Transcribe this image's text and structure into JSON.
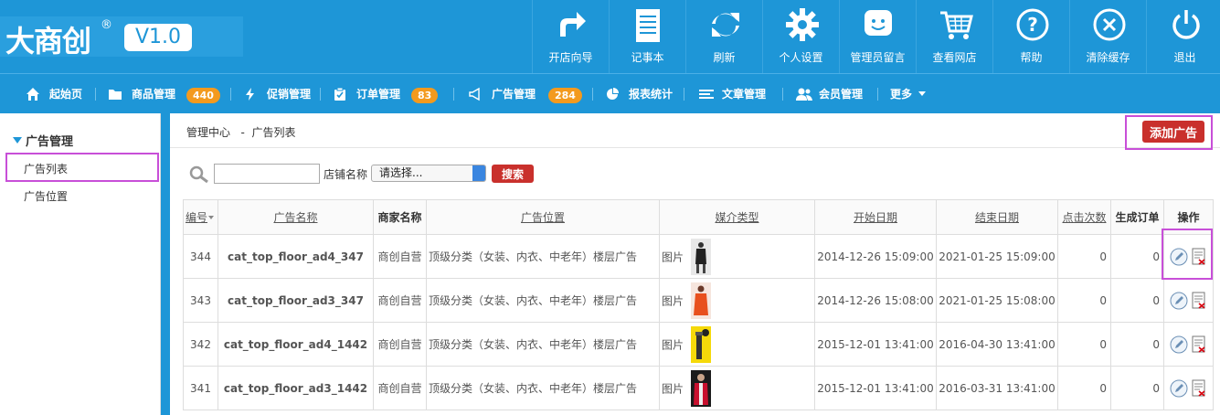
{
  "brand": {
    "logo": "大商创",
    "reg": "®",
    "version": "V1.0"
  },
  "toolbar": [
    {
      "label": "开店向导",
      "icon": "share-arrow-icon"
    },
    {
      "label": "记事本",
      "icon": "notepad-icon"
    },
    {
      "label": "刷新",
      "icon": "refresh-icon"
    },
    {
      "label": "个人设置",
      "icon": "gear-icon"
    },
    {
      "label": "管理员留言",
      "icon": "chat-smile-icon"
    },
    {
      "label": "查看网店",
      "icon": "cart-icon"
    },
    {
      "label": "帮助",
      "icon": "help-icon"
    },
    {
      "label": "清除缓存",
      "icon": "close-circle-icon"
    },
    {
      "label": "退出",
      "icon": "power-icon"
    }
  ],
  "nav": {
    "home": "起始页",
    "goods": "商品管理",
    "goods_badge": "440",
    "promo": "促销管理",
    "orders": "订单管理",
    "orders_badge": "83",
    "ads": "广告管理",
    "ads_badge": "284",
    "reports": "报表统计",
    "articles": "文章管理",
    "members": "会员管理",
    "more": "更多"
  },
  "sidebar": {
    "title": "广告管理",
    "items": [
      {
        "label": "广告列表"
      },
      {
        "label": "广告位置"
      }
    ]
  },
  "breadcrumb": {
    "root": "管理中心",
    "sep": "-",
    "current": "广告列表"
  },
  "actions": {
    "add_label": "添加广告"
  },
  "search": {
    "shop_label": "店铺名称",
    "select_value": "请选择...",
    "button": "搜索"
  },
  "table": {
    "headers": [
      "编号",
      "广告名称",
      "商家名称",
      "广告位置",
      "媒介类型",
      "开始日期",
      "结束日期",
      "点击次数",
      "生成订单",
      "操作"
    ],
    "rows": [
      {
        "id": "344",
        "name": "cat_top_floor_ad4_347",
        "shop": "商创自营",
        "position": "顶级分类（女装、内衣、中老年）楼层广告",
        "media": "图片",
        "start": "2014-12-26 15:09:00",
        "end": "2021-01-25 15:09:00",
        "clicks": "0",
        "orders": "0"
      },
      {
        "id": "343",
        "name": "cat_top_floor_ad3_347",
        "shop": "商创自营",
        "position": "顶级分类（女装、内衣、中老年）楼层广告",
        "media": "图片",
        "start": "2014-12-26 15:08:00",
        "end": "2021-01-25 15:08:00",
        "clicks": "0",
        "orders": "0"
      },
      {
        "id": "342",
        "name": "cat_top_floor_ad4_1442",
        "shop": "商创自营",
        "position": "顶级分类（女装、内衣、中老年）楼层广告",
        "media": "图片",
        "start": "2015-12-01 13:41:00",
        "end": "2016-04-30 13:41:00",
        "clicks": "0",
        "orders": "0"
      },
      {
        "id": "341",
        "name": "cat_top_floor_ad3_1442",
        "shop": "商创自营",
        "position": "顶级分类（女装、内衣、中老年）楼层广告",
        "media": "图片",
        "start": "2015-12-01 13:41:00",
        "end": "2016-03-31 13:41:00",
        "clicks": "0",
        "orders": "0"
      }
    ]
  },
  "colors": {
    "primary": "#1e96d7",
    "danger": "#c9302c",
    "badge": "#f39a1e",
    "highlight": "#c84fd8",
    "shop_text": "#d8000c"
  }
}
